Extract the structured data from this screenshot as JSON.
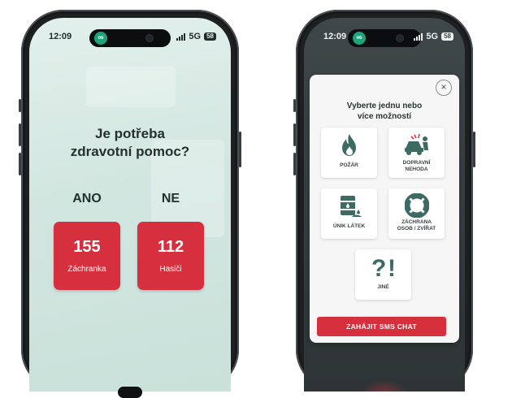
{
  "status_bar": {
    "time": "12:09",
    "network": "5G",
    "battery": "58"
  },
  "screen_one": {
    "question_line1": "Je potřeba",
    "question_line2": "zdravotní pomoc?",
    "yes_label": "ANO",
    "no_label": "NE",
    "ambulance": {
      "number": "155",
      "label": "Záchranka"
    },
    "firefighters": {
      "number": "112",
      "label": "Hasiči"
    }
  },
  "screen_two": {
    "title_line1": "Vyberte jednu nebo",
    "title_line2": "více možností",
    "close_label": "×",
    "options": [
      {
        "icon": "fire-icon",
        "line1": "POŽÁR",
        "line2": ""
      },
      {
        "icon": "car-accident-icon",
        "line1": "DOPRAVNÍ",
        "line2": "NEHODA"
      },
      {
        "icon": "chemical-barrel-icon",
        "line1": "ÚNIK LÁTEK",
        "line2": ""
      },
      {
        "icon": "lifebuoy-icon",
        "line1": "ZÁCHRANA",
        "line2": "OSOB / ZVÍŘAT"
      },
      {
        "icon": "question-exclamation-icon",
        "line1": "JINÉ",
        "line2": ""
      }
    ],
    "start_sms_button": "ZAHÁJIT SMS CHAT"
  },
  "colors": {
    "accent_red": "#d6303e",
    "icon_green": "#3d6b63",
    "screen_one_bg": "#d6e9e3"
  }
}
